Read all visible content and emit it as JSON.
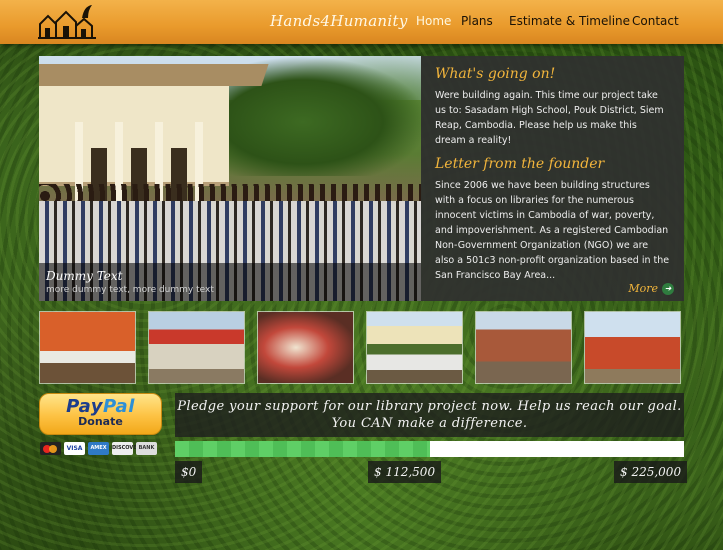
{
  "header": {
    "brand": "Hands4Humanity",
    "nav": [
      {
        "label": "Home",
        "active": true
      },
      {
        "label": "Plans",
        "active": false
      },
      {
        "label": "Estimate & Timeline",
        "active": false
      },
      {
        "label": "Contact",
        "active": false
      }
    ]
  },
  "hero": {
    "caption_title": "Dummy Text",
    "caption_text": "more dummy text, more dummy text"
  },
  "news": {
    "heading1": "What's going on!",
    "text1": "Were building again. This time our project take us to: Sasadam High School, Pouk District, Siem Reap, Cambodia.  Please help us make this dream a reality!",
    "heading2": "Letter from the founder",
    "text2": "Since 2006 we have been building structures with a focus on libraries for the numerous innocent victims in Cambodia of war, poverty, and impoverishment.  As a registered Cambodian Non-Government Organization (NGO) we are also a 501c3 non-profit organization based in the San Francisco Bay Area...",
    "more_label": "More"
  },
  "donate": {
    "paypal_pay": "Pay",
    "paypal_pal": "Pal",
    "donate_label": "Donate",
    "cards": [
      "VISA",
      "AMEX",
      "DISCOVER",
      "BANK"
    ]
  },
  "pledge": {
    "line1": "Pledge your support for our library project now. Help us reach our goal.",
    "line2": "You CAN make a difference."
  },
  "progress": {
    "fraction": 0.5,
    "start_label": "$0",
    "mid_label": "$ 112,500",
    "goal_label": "$ 225,000"
  },
  "colors": {
    "header_orange": "#e99a2c",
    "accent_gold": "#f2b53c",
    "progress_green": "#5fcf66"
  }
}
